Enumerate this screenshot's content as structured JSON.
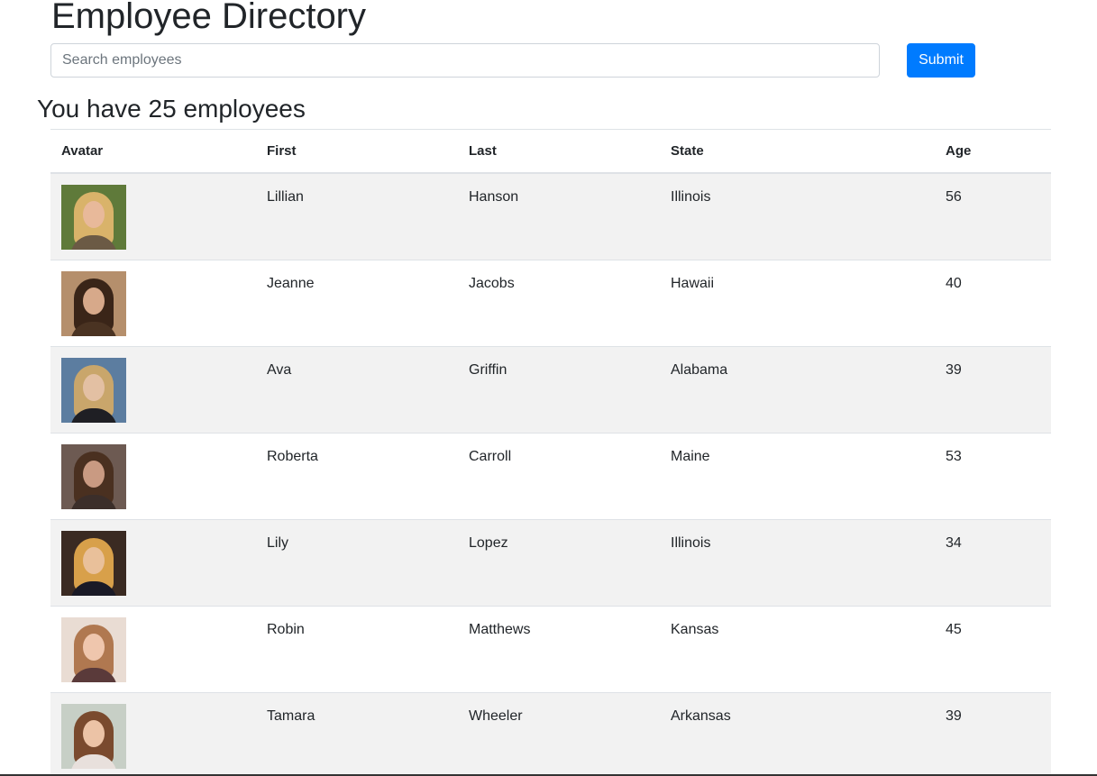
{
  "page": {
    "title": "Employee Directory",
    "count_heading": "You have 25 employees"
  },
  "search": {
    "placeholder": "Search employees",
    "value": "",
    "submit_label": "Submit"
  },
  "table": {
    "headers": [
      "Avatar",
      "First",
      "Last",
      "State",
      "Age"
    ],
    "rows": [
      {
        "first": "Lillian",
        "last": "Hanson",
        "state": "Illinois",
        "age": "56",
        "avatar": {
          "bg": "#5f7a3a",
          "hair": "#d9b36a",
          "face": "#e8b99a",
          "body": "#6b5a45"
        }
      },
      {
        "first": "Jeanne",
        "last": "Jacobs",
        "state": "Hawaii",
        "age": "40",
        "avatar": {
          "bg": "#b58f6c",
          "hair": "#3a2518",
          "face": "#d7a98a",
          "body": "#4a3322"
        }
      },
      {
        "first": "Ava",
        "last": "Griffin",
        "state": "Alabama",
        "age": "39",
        "avatar": {
          "bg": "#5c7da0",
          "hair": "#c9a66b",
          "face": "#e3c0a3",
          "body": "#1f1f24"
        }
      },
      {
        "first": "Roberta",
        "last": "Carroll",
        "state": "Maine",
        "age": "53",
        "avatar": {
          "bg": "#6d5a52",
          "hair": "#4a3020",
          "face": "#c99a82",
          "body": "#3b2e2a"
        }
      },
      {
        "first": "Lily",
        "last": "Lopez",
        "state": "Illinois",
        "age": "34",
        "avatar": {
          "bg": "#3a2a22",
          "hair": "#d8a04a",
          "face": "#e9c09a",
          "body": "#1a1a26"
        }
      },
      {
        "first": "Robin",
        "last": "Matthews",
        "state": "Kansas",
        "age": "45",
        "avatar": {
          "bg": "#e9dcd3",
          "hair": "#b07850",
          "face": "#efc6ad",
          "body": "#5a3a3a"
        }
      },
      {
        "first": "Tamara",
        "last": "Wheeler",
        "state": "Arkansas",
        "age": "39",
        "avatar": {
          "bg": "#c7cfc6",
          "hair": "#7a4a2e",
          "face": "#ecc3a6",
          "body": "#e8e0dc"
        }
      }
    ]
  },
  "colors": {
    "primary": "#007bff",
    "stripe": "#f2f2f2",
    "border": "#dee2e6"
  }
}
